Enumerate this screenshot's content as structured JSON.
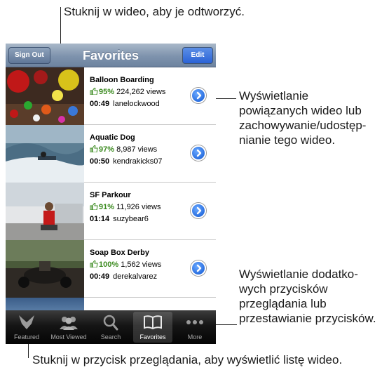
{
  "callouts": {
    "top": "Stuknij w wideo, aby je odtworzyć.",
    "right_1": [
      "Wyświetlanie",
      "powiązanych wideo lub",
      "zachowywanie/udostęp-",
      "nianie tego wideo."
    ],
    "right_2": [
      "Wyświetlanie dodatko-",
      "wych przycisków",
      "przeglądania lub",
      "przestawianie przycisków."
    ],
    "bottom": "Stuknij w przycisk przeglądania, aby wyświetlić listę wideo."
  },
  "navbar": {
    "title": "Favorites",
    "left_button": "Sign Out",
    "right_button": "Edit"
  },
  "videos": [
    {
      "title": "Balloon Boarding",
      "rating": "95%",
      "views": "224,262 views",
      "duration": "00:49",
      "user": "lanelockwood"
    },
    {
      "title": "Aquatic Dog",
      "rating": "97%",
      "views": "8,987 views",
      "duration": "00:50",
      "user": "kendrakicks07"
    },
    {
      "title": "SF Parkour",
      "rating": "91%",
      "views": "11,926 views",
      "duration": "01:14",
      "user": "suzybear6"
    },
    {
      "title": "Soap Box Derby",
      "rating": "100%",
      "views": "1,562 views",
      "duration": "00:49",
      "user": "derekalvarez"
    }
  ],
  "tabs": [
    {
      "label": "Featured",
      "icon": "featured-icon"
    },
    {
      "label": "Most Viewed",
      "icon": "most-viewed-icon"
    },
    {
      "label": "Search",
      "icon": "search-icon"
    },
    {
      "label": "Favorites",
      "icon": "favorites-icon",
      "active": true
    },
    {
      "label": "More",
      "icon": "more-icon"
    }
  ],
  "colors": {
    "rating_green": "#3a8a1e",
    "nav_blue": "#7e93ad",
    "edit_blue": "#2a62d6",
    "tabbar": "#151515"
  }
}
